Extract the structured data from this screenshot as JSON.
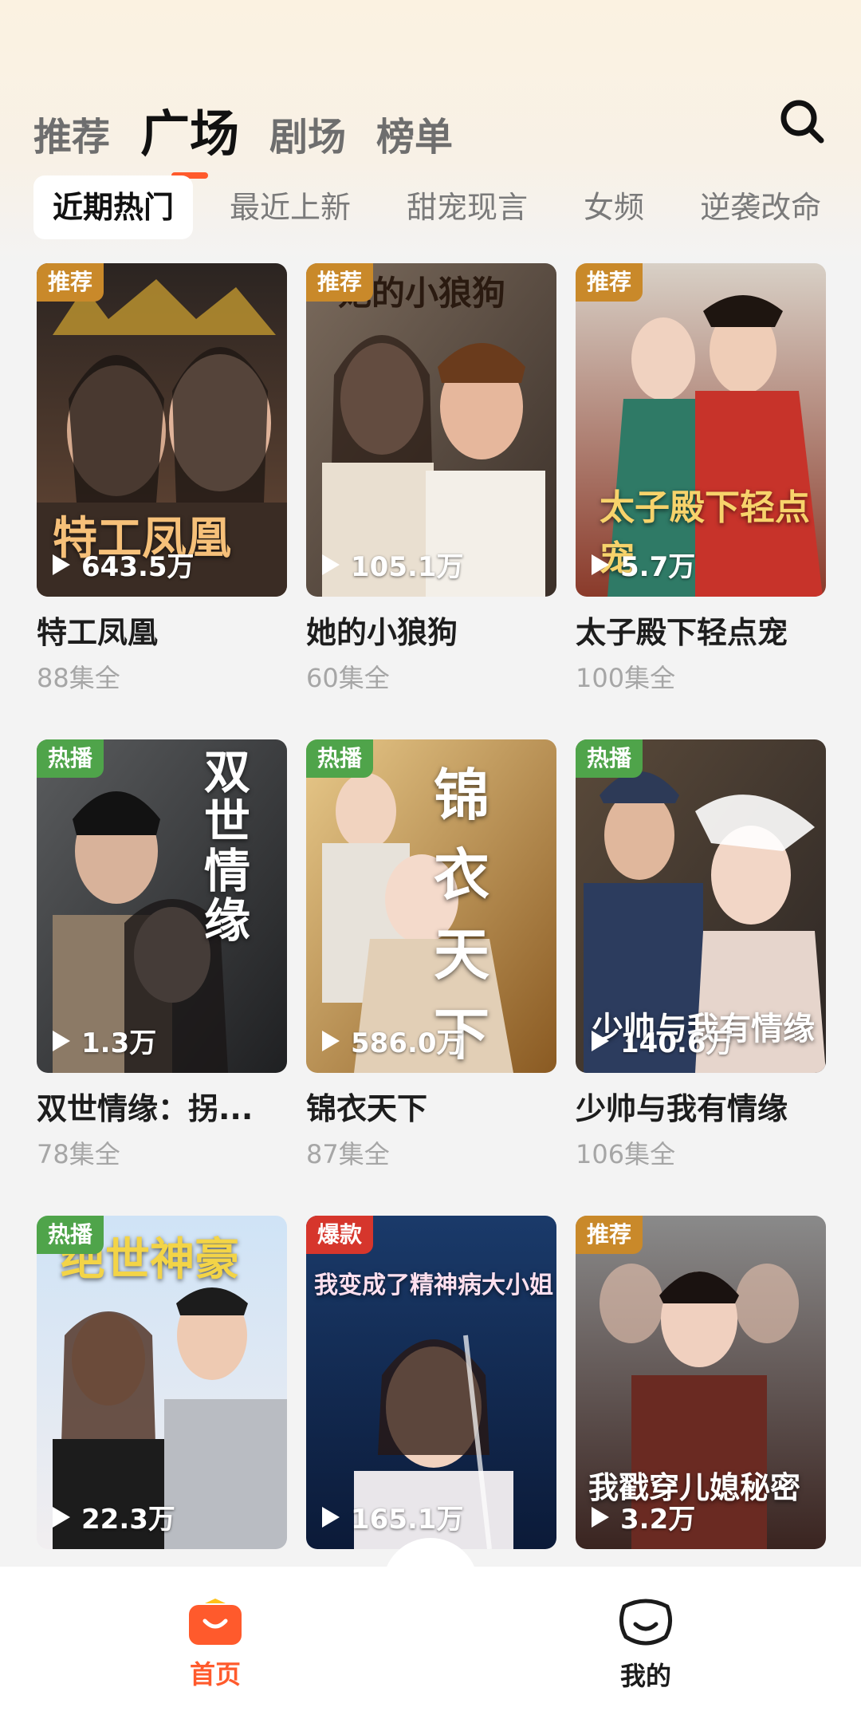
{
  "top_tabs": [
    {
      "label": "推荐",
      "active": false
    },
    {
      "label": "广场",
      "active": true
    },
    {
      "label": "剧场",
      "active": false
    },
    {
      "label": "榜单",
      "active": false
    }
  ],
  "search_icon": "search-icon",
  "chips": [
    {
      "label": "近期热门",
      "active": true
    },
    {
      "label": "最近上新",
      "active": false
    },
    {
      "label": "甜宠现言",
      "active": false
    },
    {
      "label": "女频",
      "active": false
    },
    {
      "label": "逆袭改命",
      "active": false
    }
  ],
  "colors": {
    "accent": "#ff5a2c",
    "tag_recommend": "#c9892a",
    "tag_hot": "#4fa44a",
    "tag_explosive": "#d6362c"
  },
  "dramas": [
    {
      "tag": "推荐",
      "tag_color": "#c9892a",
      "plays": "643.5万",
      "title": "特工凤凰",
      "episodes": "88集全",
      "poster_text": "特工凤凰"
    },
    {
      "tag": "推荐",
      "tag_color": "#c9892a",
      "plays": "105.1万",
      "title": "她的小狼狗",
      "episodes": "60集全",
      "poster_text": "她的小狼狗"
    },
    {
      "tag": "推荐",
      "tag_color": "#c9892a",
      "plays": "5.7万",
      "title": "太子殿下轻点宠",
      "episodes": "100集全",
      "poster_text": "太子殿下轻点宠"
    },
    {
      "tag": "热播",
      "tag_color": "#4fa44a",
      "plays": "1.3万",
      "title": "双世情缘：拐...",
      "episodes": "78集全",
      "poster_text": "双世情缘"
    },
    {
      "tag": "热播",
      "tag_color": "#4fa44a",
      "plays": "586.0万",
      "title": "锦衣天下",
      "episodes": "87集全",
      "poster_text": "锦衣天下"
    },
    {
      "tag": "热播",
      "tag_color": "#4fa44a",
      "plays": "140.6万",
      "title": "少帅与我有情缘",
      "episodes": "106集全",
      "poster_text": "少帅与我有情缘"
    },
    {
      "tag": "热播",
      "tag_color": "#4fa44a",
      "plays": "22.3万",
      "title": "",
      "episodes": "",
      "poster_text": "绝世神豪"
    },
    {
      "tag": "爆款",
      "tag_color": "#d6362c",
      "plays": "165.1万",
      "title": "",
      "episodes": "",
      "poster_text": "我变成了精神病大小姐"
    },
    {
      "tag": "推荐",
      "tag_color": "#c9892a",
      "plays": "3.2万",
      "title": "",
      "episodes": "",
      "poster_text": "我戳穿儿媳秘密"
    }
  ],
  "bottom_nav": [
    {
      "label": "首页",
      "icon": "home-icon",
      "active": true
    },
    {
      "label": "我的",
      "icon": "profile-icon",
      "active": false
    }
  ]
}
